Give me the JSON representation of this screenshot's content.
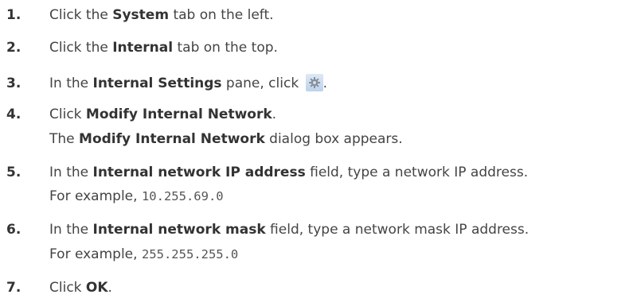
{
  "steps": [
    {
      "num": "1.",
      "pre": "Click the ",
      "bold": "System",
      "post": " tab on the left."
    },
    {
      "num": "2.",
      "pre": "Click the ",
      "bold": "Internal",
      "post": " tab on the top."
    },
    {
      "num": "3.",
      "pre": "In the ",
      "bold": "Internal Settings",
      "post": " pane, click ",
      "end": ".",
      "icon": "settings-gear-icon"
    },
    {
      "num": "4.",
      "pre": "Click ",
      "bold": "Modify Internal Network",
      "post": ".",
      "note_pre": "The ",
      "note_bold": "Modify Internal Network",
      "note_post": " dialog box appears."
    },
    {
      "num": "5.",
      "pre": "In the ",
      "bold": "Internal network IP address",
      "post": " field, type a network IP address.",
      "example_label": "For example, ",
      "example_value": "10.255.69.0"
    },
    {
      "num": "6.",
      "pre": "In the ",
      "bold": "Internal network mask",
      "post": " field, type a network mask IP address.",
      "example_label": "For example, ",
      "example_value": "255.255.255.0"
    },
    {
      "num": "7.",
      "pre": "Click ",
      "bold": "OK",
      "post": "."
    }
  ]
}
